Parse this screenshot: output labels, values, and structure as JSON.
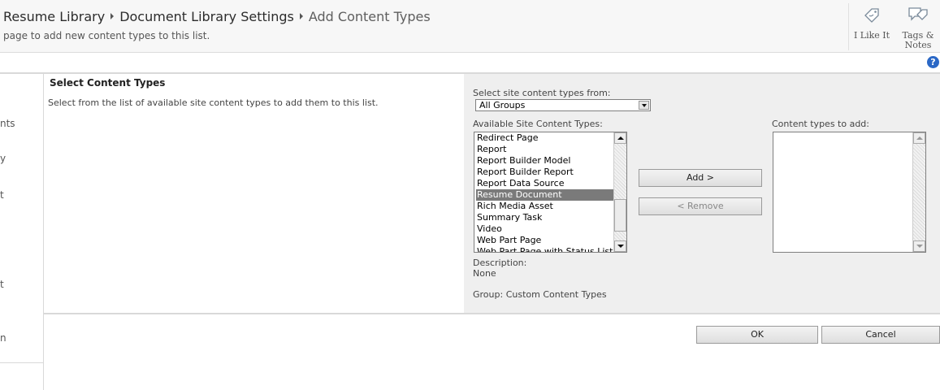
{
  "header": {
    "breadcrumb": [
      "Resume Library",
      "Document Library Settings",
      "Add Content Types"
    ],
    "subtitle": "page to add new content types to this list.",
    "ribbon": [
      {
        "label": "I Like It",
        "icon": "tag-like-icon"
      },
      {
        "label": "Tags &\nNotes",
        "icon": "tags-notes-icon"
      }
    ],
    "help_icon": "?"
  },
  "leftnav": {
    "fragments": [
      "nts",
      "y",
      "t",
      "t",
      "n"
    ]
  },
  "section": {
    "title": "Select Content Types",
    "description": "Select from the list of available site content types to add them to this list."
  },
  "form": {
    "group_label": "Select site content types from:",
    "group_value": "All Groups",
    "available_label": "Available Site Content Types:",
    "available_items": [
      "Redirect Page",
      "Report",
      "Report Builder Model",
      "Report Builder Report",
      "Report Data Source",
      "Resume Document",
      "Rich Media Asset",
      "Summary Task",
      "Video",
      "Web Part Page",
      "Web Part Page with Status List"
    ],
    "selected_item": "Resume Document",
    "add_label": "Content types to add:",
    "add_button": "Add >",
    "remove_button": "< Remove",
    "description_label": "Description:",
    "description_value": "None",
    "group_info": "Group: Custom Content Types"
  },
  "footer": {
    "ok": "OK",
    "cancel": "Cancel"
  }
}
